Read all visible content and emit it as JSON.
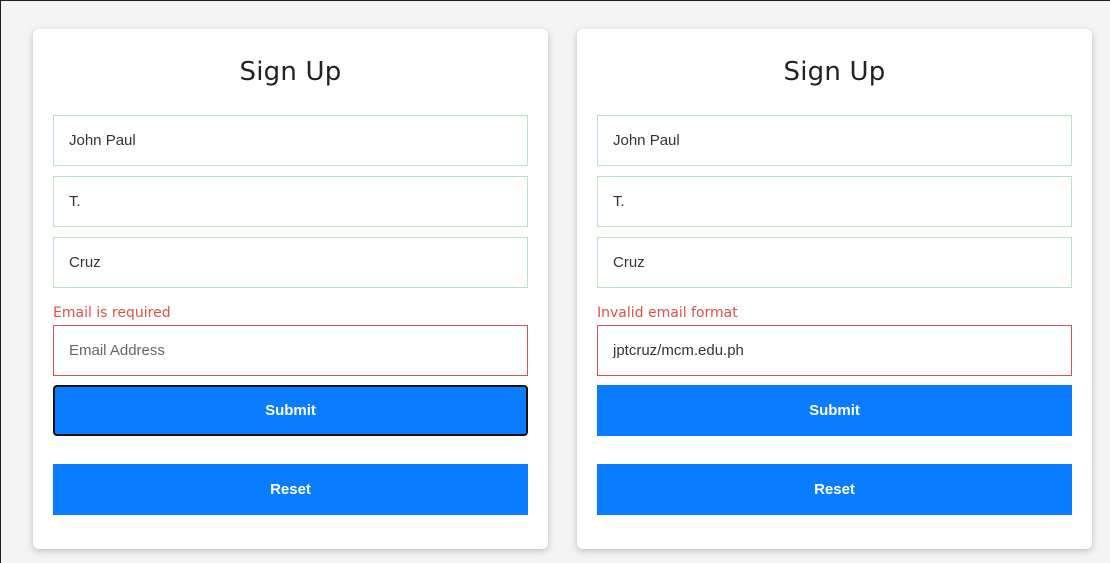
{
  "forms": [
    {
      "title": "Sign Up",
      "first_name": "John Paul",
      "middle_name": "T.",
      "last_name": "Cruz",
      "email_error": "Email is required",
      "email_placeholder": "Email Address",
      "email_value": "",
      "submit_label": "Submit",
      "reset_label": "Reset"
    },
    {
      "title": "Sign Up",
      "first_name": "John Paul",
      "middle_name": "T.",
      "last_name": "Cruz",
      "email_error": "Invalid email format",
      "email_placeholder": "",
      "email_value": "jptcruz/mcm.edu.ph",
      "submit_label": "Submit",
      "reset_label": "Reset"
    }
  ],
  "colors": {
    "primary": "#0a7cff",
    "error": "#e0504a",
    "valid_border": "#b9e3c3"
  }
}
